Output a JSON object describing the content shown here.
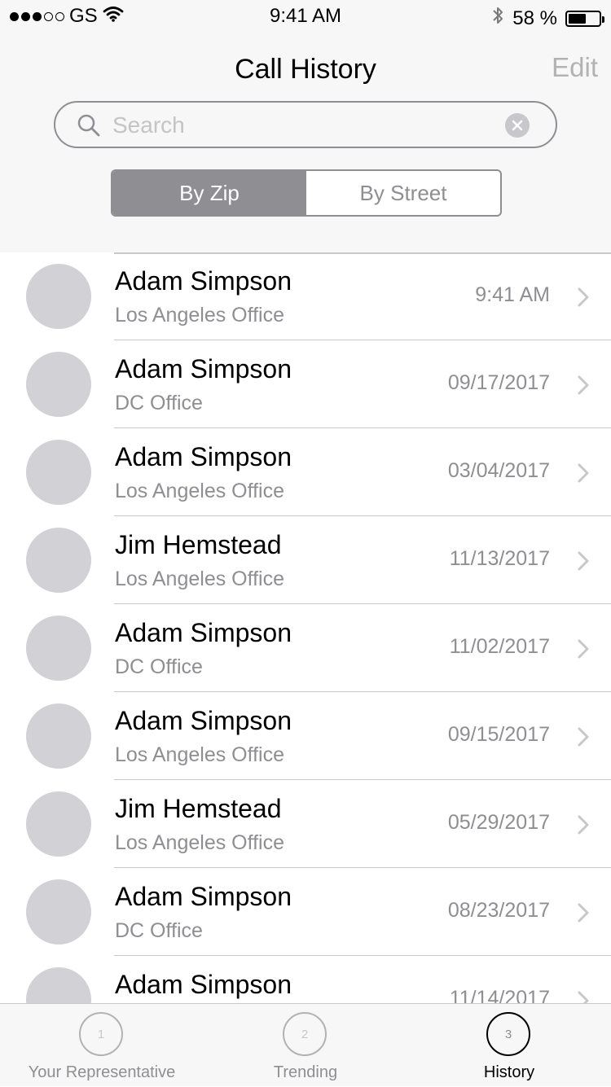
{
  "status_bar": {
    "carrier": "GS",
    "time": "9:41 AM",
    "battery_percent": "58 %",
    "battery_level": 0.58,
    "signal_bars_filled": 3,
    "signal_bars_total": 5
  },
  "header": {
    "title": "Call History",
    "edit_label": "Edit"
  },
  "search": {
    "placeholder": "Search",
    "value": ""
  },
  "segment": {
    "options": [
      "By Zip",
      "By Street"
    ],
    "selected": "By Zip"
  },
  "calls": [
    {
      "name": "Adam Simpson",
      "office": "Los Angeles Office",
      "date": "9:41 AM"
    },
    {
      "name": "Adam Simpson",
      "office": "DC Office",
      "date": "09/17/2017"
    },
    {
      "name": "Adam Simpson",
      "office": "Los Angeles Office",
      "date": "03/04/2017"
    },
    {
      "name": "Jim Hemstead",
      "office": "Los Angeles Office",
      "date": "11/13/2017"
    },
    {
      "name": "Adam Simpson",
      "office": "DC Office",
      "date": "11/02/2017"
    },
    {
      "name": "Adam Simpson",
      "office": "Los Angeles Office",
      "date": "09/15/2017"
    },
    {
      "name": "Jim Hemstead",
      "office": "Los Angeles Office",
      "date": "05/29/2017"
    },
    {
      "name": "Adam Simpson",
      "office": "DC Office",
      "date": "08/23/2017"
    },
    {
      "name": "Adam Simpson",
      "office": "",
      "date": "11/14/2017"
    }
  ],
  "tabs": [
    {
      "number": "1",
      "label": "Your Representative"
    },
    {
      "number": "2",
      "label": "Trending"
    },
    {
      "number": "3",
      "label": "History"
    }
  ],
  "active_tab": "History",
  "colors": {
    "background": "#f7f7f7",
    "secondary_text": "#8e8e93",
    "avatar": "#d1d1d6",
    "segment_active": "#8e8e93"
  }
}
